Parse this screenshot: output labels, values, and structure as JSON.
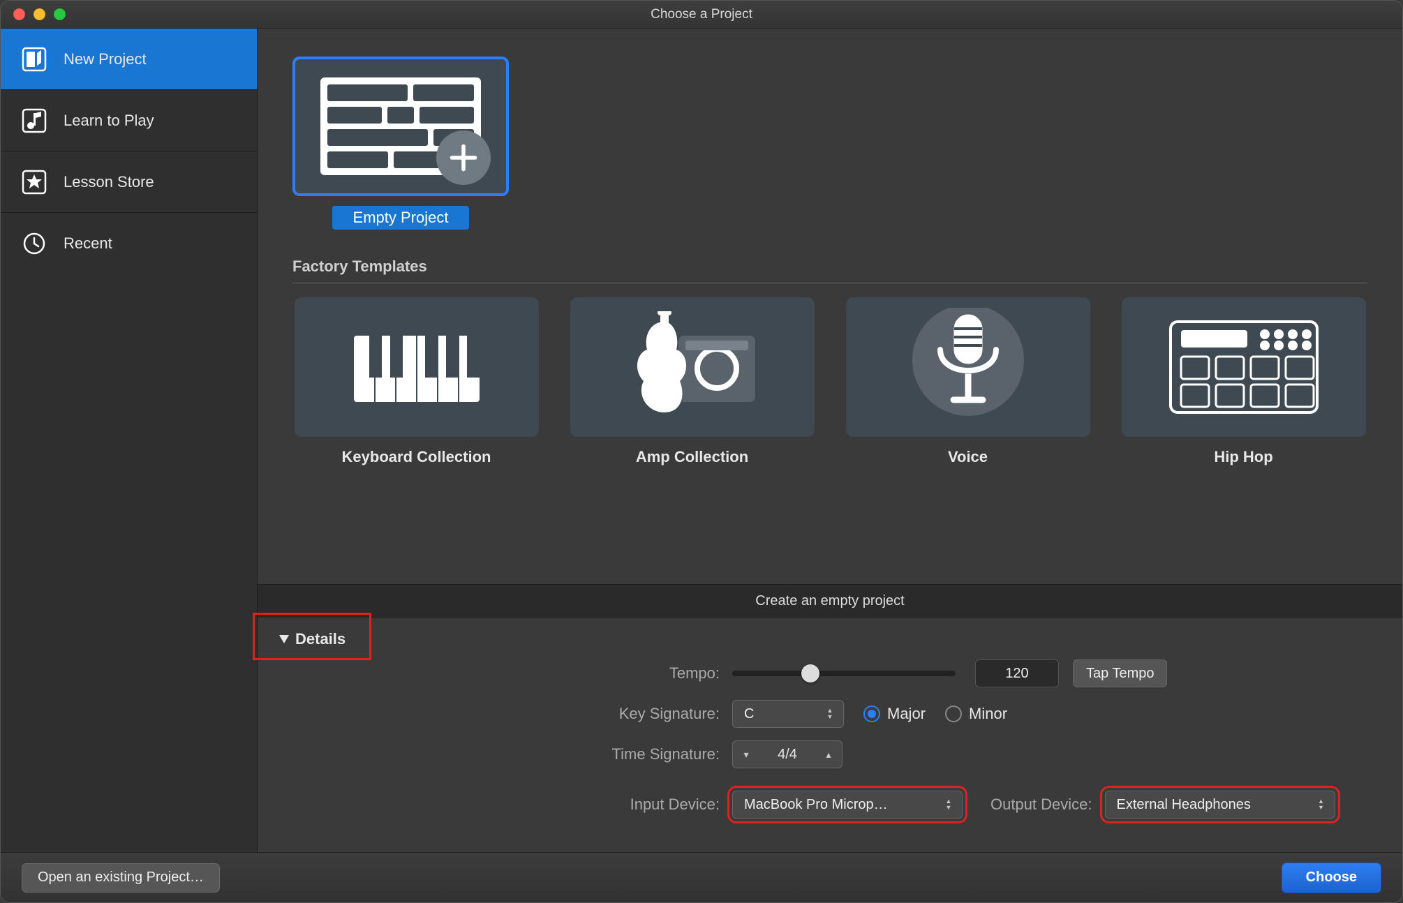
{
  "window": {
    "title": "Choose a Project"
  },
  "sidebar": {
    "items": [
      {
        "label": "New Project",
        "selected": true
      },
      {
        "label": "Learn to Play",
        "selected": false
      },
      {
        "label": "Lesson Store",
        "selected": false
      },
      {
        "label": "Recent",
        "selected": false
      }
    ]
  },
  "emptyProject": {
    "label": "Empty Project"
  },
  "factoryTemplates": {
    "heading": "Factory Templates",
    "items": [
      {
        "label": "Keyboard Collection"
      },
      {
        "label": "Amp Collection"
      },
      {
        "label": "Voice"
      },
      {
        "label": "Hip Hop"
      }
    ]
  },
  "descriptionBar": "Create an empty project",
  "details": {
    "toggleLabel": "Details",
    "tempo": {
      "label": "Tempo:",
      "value": "120",
      "tapLabel": "Tap Tempo"
    },
    "keySignature": {
      "label": "Key Signature:",
      "value": "C",
      "majorLabel": "Major",
      "minorLabel": "Minor",
      "mode": "Major"
    },
    "timeSignature": {
      "label": "Time Signature:",
      "value": "4/4"
    },
    "inputDevice": {
      "label": "Input Device:",
      "value": "MacBook Pro Microp…"
    },
    "outputDevice": {
      "label": "Output Device:",
      "value": "External Headphones"
    }
  },
  "footer": {
    "openLabel": "Open an existing Project…",
    "chooseLabel": "Choose"
  }
}
